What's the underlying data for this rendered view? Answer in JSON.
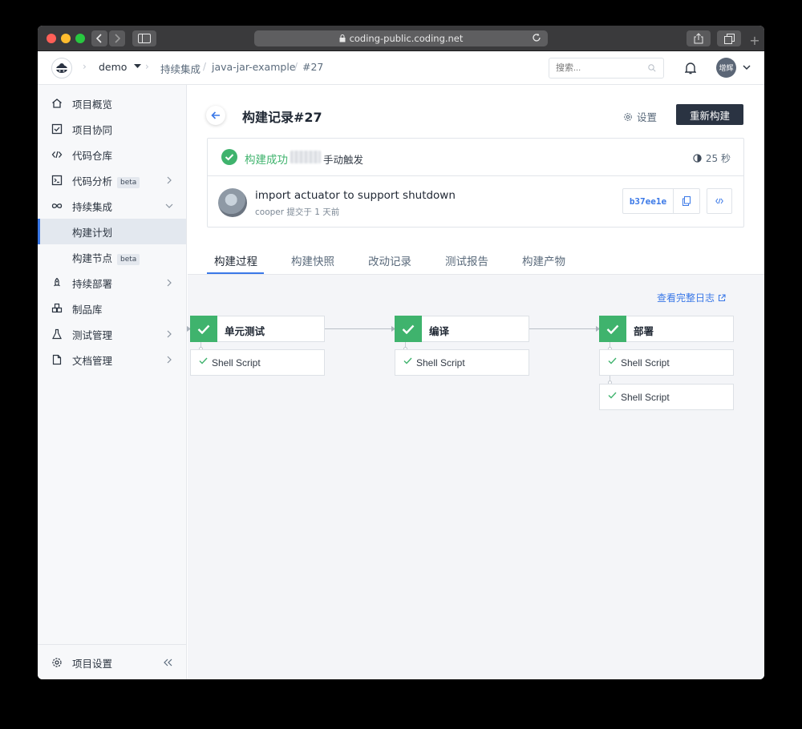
{
  "browser": {
    "url": "coding-public.coding.net"
  },
  "topnav": {
    "project": "demo",
    "breadcrumbs": [
      "持续集成",
      "java-jar-example",
      "#27"
    ],
    "search_placeholder": "搜索...",
    "user_avatar_text": "增辉"
  },
  "sidebar": {
    "items": [
      {
        "label": "项目概览",
        "icon": "home-icon"
      },
      {
        "label": "项目协同",
        "icon": "checkbox-icon"
      },
      {
        "label": "代码仓库",
        "icon": "code-icon"
      },
      {
        "label": "代码分析",
        "icon": "terminal-icon",
        "badge": "beta"
      },
      {
        "label": "持续集成",
        "icon": "infinity-icon"
      },
      {
        "label": "构建计划"
      },
      {
        "label": "构建节点",
        "badge": "beta"
      },
      {
        "label": "持续部署",
        "icon": "rocket-icon"
      },
      {
        "label": "制品库",
        "icon": "package-icon"
      },
      {
        "label": "测试管理",
        "icon": "flask-icon"
      },
      {
        "label": "文档管理",
        "icon": "document-icon"
      }
    ],
    "footer_label": "项目设置"
  },
  "header": {
    "title": "构建记录#27",
    "settings_label": "设置",
    "rebuild_label": "重新构建"
  },
  "build": {
    "status_text": "构建成功",
    "trigger_text": "手动触发",
    "duration": "25 秒",
    "commit_message": "import actuator to support shutdown",
    "commit_meta": "cooper 提交于 1 天前",
    "commit_sha": "b37ee1e"
  },
  "tabs": [
    "构建过程",
    "构建快照",
    "改动记录",
    "测试报告",
    "构建产物"
  ],
  "pipeline": {
    "full_log_label": "查看完整日志",
    "stages": [
      {
        "name": "单元测试",
        "steps": [
          "Shell Script"
        ]
      },
      {
        "name": "编译",
        "steps": [
          "Shell Script"
        ]
      },
      {
        "name": "部署",
        "steps": [
          "Shell Script",
          "Shell Script"
        ]
      }
    ]
  },
  "colors": {
    "success": "#3fb36d",
    "accent": "#3a78e7",
    "primary_button": "#2a3342"
  }
}
